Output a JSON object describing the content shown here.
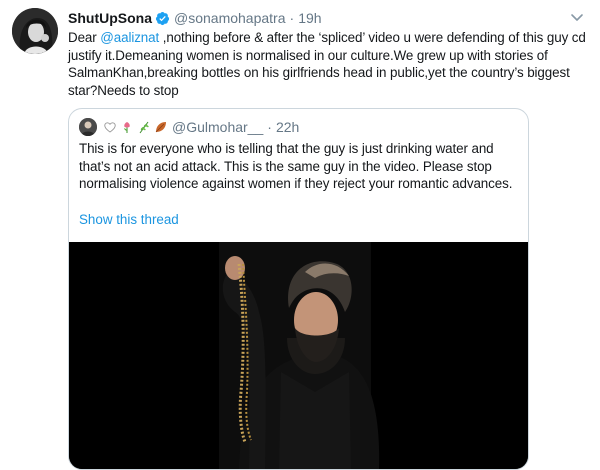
{
  "tweet": {
    "display_name": "ShutUpSona",
    "verified_icon": "verified-badge-icon",
    "handle": "@sonamohapatra",
    "separator": "·",
    "time": "19h",
    "more_icon": "chevron-down-icon",
    "text_prefix": "Dear ",
    "mention": "@aaliznat",
    "text_suffix": " ,nothing before & after the ‘spliced’ video u were defending of this guy cd justify it.Demeaning women is normalised in our culture.We grew up with stories of SalmanKhan,breaking bottles on his girlfriends head in public,yet the country’s biggest star?Needs to stop"
  },
  "quoted_tweet": {
    "emojis": [
      "🤍",
      "🌷",
      "🌿",
      "🍂"
    ],
    "handle": "@Gulmohar__",
    "separator": "·",
    "time": "22h",
    "text": "This is for everyone who is telling that the guy is just drinking water and that’s not an acid attack. This is the same guy in the video. Please stop normalising violence against women if they reject your romantic advances.",
    "show_thread": "Show this thread"
  },
  "colors": {
    "link": "#1b95e0",
    "secondary_text": "#657786",
    "border": "#ccd6dd",
    "verified": "#1da1f2"
  }
}
